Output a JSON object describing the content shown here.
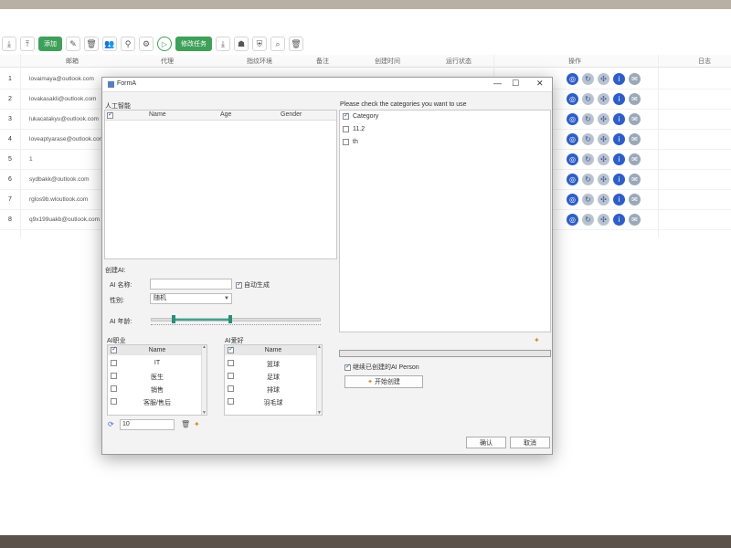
{
  "toolbar": {
    "add_label": "添加",
    "batch_task_label": "修改任务"
  },
  "table": {
    "headers": {
      "email": "邮箱",
      "proxy": "代理",
      "env": "指纹环境",
      "note": "备注",
      "created": "创建时间",
      "status": "运行状态",
      "ops": "操作",
      "log": "日志"
    },
    "rows": [
      {
        "num": "1",
        "email": "lovaimaya@outlook.com"
      },
      {
        "num": "2",
        "email": "lovakasakli@outlook.com"
      },
      {
        "num": "3",
        "email": "lukacatakyu@outlook.com"
      },
      {
        "num": "4",
        "email": "loveaptyarase@outlook.com"
      },
      {
        "num": "5",
        "email": "1"
      },
      {
        "num": "6",
        "email": "sydbakk@outlook.com"
      },
      {
        "num": "7",
        "email": "rglos9b.wloutlook.com"
      },
      {
        "num": "8",
        "email": "q9x199uakb@outlook.com"
      }
    ]
  },
  "dialog": {
    "title": "FormA",
    "left_header": "人工智能",
    "columns": [
      "Name",
      "Age",
      "Gender"
    ],
    "right_hint": "Please check the categories you want to use",
    "categories": [
      {
        "label": "Category",
        "checked": true
      },
      {
        "label": "11.2",
        "checked": false
      },
      {
        "label": "th",
        "checked": false
      }
    ],
    "create_label": "创建AI:",
    "ai_name_label": "AI 名称:",
    "auto_gen_label": "自动生成",
    "gender_label": "性别:",
    "gender_value": "随机",
    "age_label": "AI 年龄:",
    "occupation_title": "AI职业",
    "occupation_items": [
      "Name",
      "IT",
      "医生",
      "销售",
      "客服/售后"
    ],
    "hobby_title": "AI爱好",
    "hobby_items": [
      "Name",
      "篮球",
      "足球",
      "排球",
      "羽毛球"
    ],
    "count_value": "10",
    "progress": 0.0,
    "continue_label": "继续已创建的AI Person",
    "start_button": "开始创建",
    "ok_button": "确认",
    "cancel_button": "取消"
  }
}
